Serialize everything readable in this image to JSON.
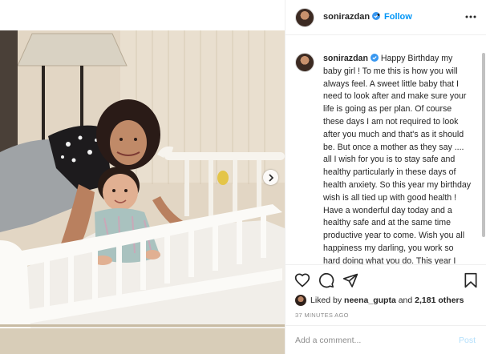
{
  "post": {
    "username": "sonirazdan",
    "follow_label": "Follow",
    "separator": "•",
    "caption_text": "Happy Birthday my baby girl ! To me this is how you will always feel. A sweet little baby that I need to look after and make sure your life is going as per plan. Of course these days I am not required to look after you much and that's as it should be. But once a mother as they say .... all I wish for you is to stay safe and healthy particularly in these days of health anxiety. So this year my birthday wish is all tied up with good health ! Have a wonderful day today and a healthy safe and at the same time productive year to come. Wish you all happiness my darling, you work so hard doing what you do. This year I hope you have a super successful year and also have a little more time for yourself. To breathe, to",
    "likes": {
      "prefix": "Liked by",
      "liker": "neena_gupta",
      "connector": "and",
      "count": "2,181 others"
    },
    "timestamp": "37 MINUTES AGO",
    "comment": {
      "placeholder": "Add a comment...",
      "post_label": "Post"
    }
  },
  "colors": {
    "link_blue": "#0095f6",
    "post_disabled": "#b2dffc",
    "muted_gray": "#8e8e8e",
    "text": "#262626",
    "verified_blue": "#3897f0"
  },
  "icons": [
    "verified-badge-icon",
    "more-options-icon",
    "heart-icon",
    "comment-icon",
    "share-icon",
    "bookmark-icon",
    "chevron-right-icon"
  ]
}
